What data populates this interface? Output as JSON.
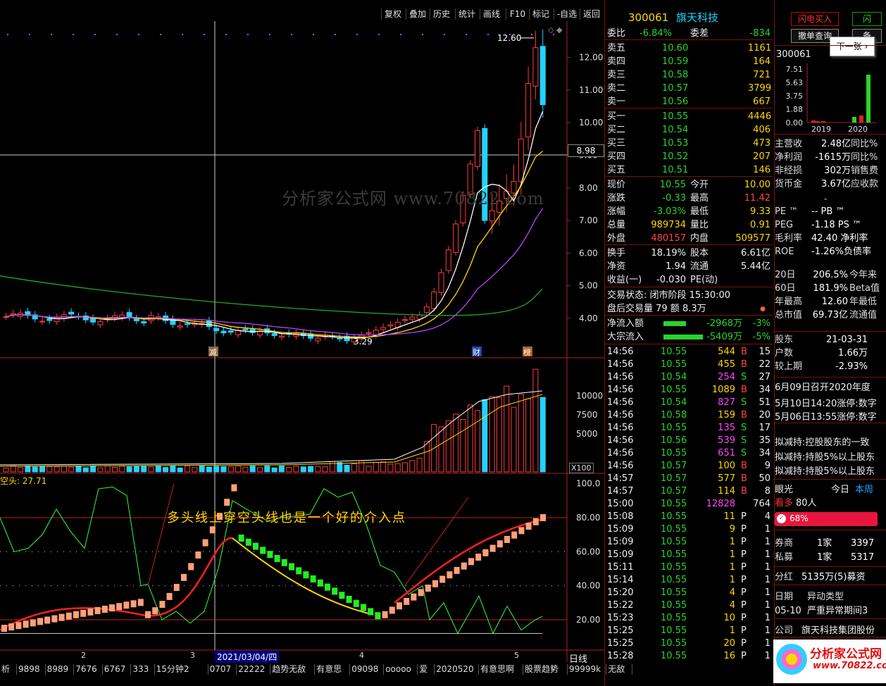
{
  "toolbar": {
    "items": [
      "复权",
      "叠加",
      "历史",
      "统计",
      "画线",
      "F10",
      "标记",
      "-自选",
      "返回"
    ]
  },
  "stock": {
    "code": "300061",
    "name": "旗天科技"
  },
  "order": {
    "weibi_label": "委比",
    "weibi": "-6.84%",
    "weicha_label": "委差",
    "weicha": "-834"
  },
  "asks": [
    {
      "label": "卖五",
      "price": "10.60",
      "vol": "1161"
    },
    {
      "label": "卖四",
      "price": "10.59",
      "vol": "164"
    },
    {
      "label": "卖三",
      "price": "10.58",
      "vol": "721"
    },
    {
      "label": "卖二",
      "price": "10.57",
      "vol": "3799"
    },
    {
      "label": "卖一",
      "price": "10.56",
      "vol": "667"
    }
  ],
  "bids": [
    {
      "label": "买一",
      "price": "10.55",
      "vol": "4446"
    },
    {
      "label": "买二",
      "price": "10.54",
      "vol": "406"
    },
    {
      "label": "买三",
      "price": "10.53",
      "vol": "473"
    },
    {
      "label": "买四",
      "price": "10.52",
      "vol": "207"
    },
    {
      "label": "买五",
      "price": "10.51",
      "vol": "146"
    }
  ],
  "quote": [
    {
      "l1": "现价",
      "v1": "10.55",
      "l2": "今开",
      "v2": "10.00"
    },
    {
      "l1": "涨跌",
      "v1": "-0.33",
      "l2": "最高",
      "v2": "11.42"
    },
    {
      "l1": "涨幅",
      "v1": "-3.03%",
      "l2": "最低",
      "v2": "9.33"
    },
    {
      "l1": "总量",
      "v1": "989734",
      "l2": "量比",
      "v2": "0.91"
    },
    {
      "l1": "外盘",
      "v1": "480157",
      "l2": "内盘",
      "v2": "509577"
    }
  ],
  "stats": [
    {
      "l1": "换手",
      "v1": "18.19%",
      "l2": "股本",
      "v2": "6.61亿"
    },
    {
      "l1": "净资",
      "v1": "1.94",
      "l2": "流通",
      "v2": "5.44亿"
    },
    {
      "l1": "收益(一)",
      "v1": "-0.030",
      "l2": "PE(动)",
      "v2": ""
    }
  ],
  "status": {
    "line1": "交易状态: 闭市阶段 15:30:00",
    "line2": "盘后交易量 79 额 8.3万"
  },
  "flow": [
    {
      "label": "净流入额",
      "value": "-2968万",
      "pct": "-3%"
    },
    {
      "label": "大宗流入",
      "value": "-5409万",
      "pct": "-5%"
    }
  ],
  "ticks": [
    [
      "14:56",
      "10.55",
      "544",
      "B",
      "15"
    ],
    [
      "14:56",
      "10.55",
      "455",
      "B",
      "22"
    ],
    [
      "14:56",
      "10.54",
      "254",
      "S",
      "27"
    ],
    [
      "14:56",
      "10.55",
      "1089",
      "B",
      "34"
    ],
    [
      "14:56",
      "10.54",
      "827",
      "S",
      "51"
    ],
    [
      "14:56",
      "10.58",
      "159",
      "B",
      "20"
    ],
    [
      "14:56",
      "10.55",
      "135",
      "S",
      "17"
    ],
    [
      "14:56",
      "10.56",
      "539",
      "S",
      "35"
    ],
    [
      "14:56",
      "10.55",
      "651",
      "S",
      "34"
    ],
    [
      "14:56",
      "10.57",
      "100",
      "B",
      "9"
    ],
    [
      "14:57",
      "10.57",
      "577",
      "B",
      "50"
    ],
    [
      "14:57",
      "10.57",
      "114",
      "B",
      "8"
    ],
    [
      "15:00",
      "10.55",
      "12828",
      "",
      "764"
    ],
    [
      "15:08",
      "10.55",
      "11",
      "P",
      "4"
    ],
    [
      "15:09",
      "10.55",
      "9",
      "P",
      "1"
    ],
    [
      "15:09",
      "10.55",
      "1",
      "P",
      "1"
    ],
    [
      "15:09",
      "10.55",
      "1",
      "P",
      "1"
    ],
    [
      "15:11",
      "10.55",
      "1",
      "P",
      "1"
    ],
    [
      "15:14",
      "10.55",
      "1",
      "P",
      "1"
    ],
    [
      "15:20",
      "10.55",
      "4",
      "P",
      "1"
    ],
    [
      "15:22",
      "10.55",
      "4",
      "P",
      "1"
    ],
    [
      "15:23",
      "10.55",
      "10",
      "P",
      "1"
    ],
    [
      "15:25",
      "10.55",
      "1",
      "P",
      "1"
    ],
    [
      "15:25",
      "10.55",
      "20",
      "P",
      "1"
    ],
    [
      "15:28",
      "10.55",
      "16",
      "P",
      "1"
    ]
  ],
  "far": {
    "btn1": "闪电买入",
    "btn2": "闪",
    "btn3": "撤单查询",
    "btn4": "备",
    "next": "下一张",
    "mini_code": "300061",
    "mini_y": [
      "7.51",
      "5.63",
      "3.75",
      "1.88",
      "0.00"
    ],
    "mini_x": [
      "2019",
      "2020"
    ],
    "fin": [
      [
        "主营收",
        "2.48亿",
        "同比%"
      ],
      [
        "净利润",
        "-1615万",
        "同比%"
      ],
      [
        "非经损",
        "302万",
        "销售费"
      ],
      [
        "货币金",
        "3.67亿",
        "应收款"
      ]
    ],
    "ratios": [
      [
        "PE ™",
        "-- PB ™"
      ],
      [
        "PEG",
        "-1.18 PS ™"
      ],
      [
        "毛利率",
        "42.40 净利率"
      ],
      [
        "ROE",
        "-1.26%负债率"
      ]
    ],
    "perf": [
      [
        "20日",
        "206.5%",
        "今年来"
      ],
      [
        "60日",
        "181.9%",
        "Beta值"
      ],
      [
        "年最高",
        "12.60",
        "年最低"
      ],
      [
        "总市值",
        "69.73亿",
        "流通值"
      ]
    ],
    "holder": [
      [
        "股东",
        "21-03-31"
      ],
      [
        "户数",
        "1.66万"
      ],
      [
        "较上期",
        "-2.93%"
      ]
    ],
    "news": [
      "6月09日召开2020年度",
      "5月10日14:20涨停:数字",
      "5月06日13:55涨停:数字",
      "拟减持:控股股东的一致",
      "拟减持:持股5%以上股东",
      "拟减持:持股5%以上股东"
    ],
    "eye": "眼光",
    "today": "今日",
    "week": "本周",
    "kanduo": "看多",
    "kanduo_n": "80人",
    "pct": "68%",
    "broker": [
      [
        "券商",
        "1家",
        "3397"
      ],
      [
        "私募",
        "1家",
        "5317"
      ]
    ],
    "fenhong": [
      "分红",
      "5135万(5)募资"
    ],
    "abn_head": [
      "日期",
      "异动类型"
    ],
    "abn_row": [
      "05-10",
      "严重异常期间3"
    ],
    "company": [
      "公司",
      "旗天科技集团股份"
    ],
    "brand": "分析家公式网",
    "brand_url": "www.70822.com"
  },
  "chart": {
    "price_ticks": [
      "12.00",
      "11.00",
      "10.00",
      "9.00",
      "8.00",
      "7.00",
      "6.00",
      "5.00",
      "4.00"
    ],
    "cur_price": "8.98",
    "high_label": "12.60",
    "low_label": "3.29",
    "markers": [
      "减",
      "财",
      "榜"
    ],
    "vol_ticks": [
      "10000",
      "7500",
      "5000"
    ],
    "vol_unit": "X100",
    "ind_name": "空头: 27.71",
    "ind_ticks": [
      "100.0",
      "80.00",
      "60.00",
      "40.00",
      "20.00"
    ],
    "annotation": "多头线上穿空头线也是一个好的介入点",
    "x_labels": [
      "2",
      "3",
      "4",
      "5"
    ],
    "date_label": "2021/03/04/四",
    "period": "日线",
    "watermark": "分析家公式网 www.70822.com"
  },
  "bottom": [
    "析",
    "9898",
    "8989",
    "7676",
    "6767",
    "333",
    "15分钟2",
    "0707",
    "22222",
    "趋势无敌",
    "有意思",
    "09098",
    "ooooo",
    "爱",
    "2020520",
    "有意思啊",
    "股票趋势",
    "99999k",
    "无敌"
  ],
  "chart_data": {
    "type": "candlestick",
    "title": "300061 旗天科技",
    "ylim": [
      3.0,
      12.8
    ],
    "high": 12.6,
    "low": 3.29,
    "last": 10.55
  }
}
